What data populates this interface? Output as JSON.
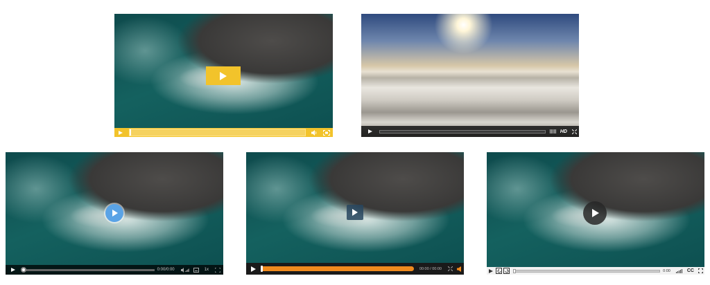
{
  "players": [
    {
      "id": "player-1",
      "theme": "yellow",
      "accent": "#f2c32b",
      "controls": {
        "play": "play-icon",
        "volume": "volume-icon",
        "fullscreen": "fullscreen-icon"
      }
    },
    {
      "id": "player-2",
      "theme": "dark-hd",
      "controls": {
        "play": "play-icon",
        "quality": "HD",
        "fullscreen": "fullscreen-icon"
      }
    },
    {
      "id": "player-3",
      "theme": "blue-circle",
      "accent": "#5aa3e6",
      "time": "0:00/0:00",
      "speed": "1x"
    },
    {
      "id": "player-4",
      "theme": "orange",
      "accent": "#f08a1e",
      "time": "00:00 / 00:00"
    },
    {
      "id": "player-5",
      "theme": "light-gray",
      "time": "0:00",
      "cc": "CC"
    }
  ]
}
